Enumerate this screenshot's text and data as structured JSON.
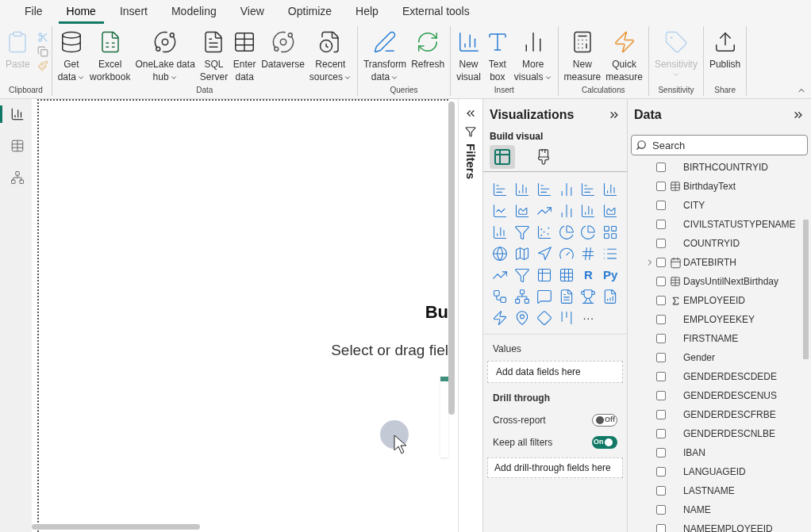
{
  "menu_tabs": [
    {
      "label": "File",
      "selected": false
    },
    {
      "label": "Home",
      "selected": true
    },
    {
      "label": "Insert",
      "selected": false
    },
    {
      "label": "Modeling",
      "selected": false
    },
    {
      "label": "View",
      "selected": false
    },
    {
      "label": "Optimize",
      "selected": false
    },
    {
      "label": "Help",
      "selected": false
    },
    {
      "label": "External tools",
      "selected": false
    }
  ],
  "ribbon": {
    "groups": [
      {
        "kind": "clipboard",
        "label": "Clipboard",
        "buttons": [
          {
            "label_lines": [
              "Paste"
            ],
            "menu": false,
            "disabled": true
          }
        ]
      },
      {
        "kind": "large",
        "label": "Data",
        "buttons": [
          {
            "label_lines": [
              "Get",
              "data"
            ],
            "menu": true,
            "disabled": false
          },
          {
            "label_lines": [
              "Excel",
              "workbook"
            ],
            "menu": false,
            "disabled": false
          },
          {
            "label_lines": [
              "OneLake data",
              "hub"
            ],
            "menu": true,
            "disabled": false
          },
          {
            "label_lines": [
              "SQL",
              "Server"
            ],
            "menu": false,
            "disabled": false
          },
          {
            "label_lines": [
              "Enter",
              "data"
            ],
            "menu": false,
            "disabled": false
          },
          {
            "label_lines": [
              "Dataverse"
            ],
            "menu": false,
            "disabled": false
          },
          {
            "label_lines": [
              "Recent",
              "sources"
            ],
            "menu": true,
            "disabled": false
          }
        ]
      },
      {
        "kind": "large",
        "label": "Queries",
        "buttons": [
          {
            "label_lines": [
              "Transform",
              "data"
            ],
            "menu": true,
            "disabled": false
          },
          {
            "label_lines": [
              "Refresh"
            ],
            "menu": false,
            "disabled": false
          }
        ]
      },
      {
        "kind": "large",
        "label": "Insert",
        "buttons": [
          {
            "label_lines": [
              "New",
              "visual"
            ],
            "menu": false,
            "disabled": false
          },
          {
            "label_lines": [
              "Text",
              "box"
            ],
            "menu": false,
            "disabled": false
          },
          {
            "label_lines": [
              "More",
              "visuals"
            ],
            "menu": true,
            "disabled": false
          }
        ]
      },
      {
        "kind": "large",
        "label": "Calculations",
        "buttons": [
          {
            "label_lines": [
              "New",
              "measure"
            ],
            "menu": false,
            "disabled": false
          },
          {
            "label_lines": [
              "Quick",
              "measure"
            ],
            "menu": false,
            "disabled": false
          }
        ]
      },
      {
        "kind": "large",
        "label": "Sensitivity",
        "buttons": [
          {
            "label_lines": [
              "Sensitivity"
            ],
            "menu": true,
            "disabled": true
          }
        ]
      },
      {
        "kind": "large",
        "label": "Share",
        "buttons": [
          {
            "label_lines": [
              "Publish"
            ],
            "menu": false,
            "disabled": false
          }
        ]
      }
    ]
  },
  "nav": [
    {
      "selected": true
    },
    {
      "selected": false
    },
    {
      "selected": false
    }
  ],
  "canvas": {
    "title": "Bu",
    "subtitle": "Select or drag fiel"
  },
  "filters": {
    "label": "Filters"
  },
  "visualizations": {
    "title": "Visualizations",
    "section": "Build visual",
    "build_tabs": [
      {
        "selected": true
      },
      {
        "selected": false
      }
    ],
    "gallery": [
      {
        "kind": "icon"
      },
      {
        "kind": "icon"
      },
      {
        "kind": "icon"
      },
      {
        "kind": "icon"
      },
      {
        "kind": "icon"
      },
      {
        "kind": "icon"
      },
      {
        "kind": "icon"
      },
      {
        "kind": "icon"
      },
      {
        "kind": "icon"
      },
      {
        "kind": "icon"
      },
      {
        "kind": "icon"
      },
      {
        "kind": "icon"
      },
      {
        "kind": "icon"
      },
      {
        "kind": "icon"
      },
      {
        "kind": "icon"
      },
      {
        "kind": "icon"
      },
      {
        "kind": "icon"
      },
      {
        "kind": "icon"
      },
      {
        "kind": "icon"
      },
      {
        "kind": "icon"
      },
      {
        "kind": "icon"
      },
      {
        "kind": "icon"
      },
      {
        "kind": "icon"
      },
      {
        "kind": "icon"
      },
      {
        "kind": "icon"
      },
      {
        "kind": "icon"
      },
      {
        "kind": "icon"
      },
      {
        "kind": "icon"
      },
      {
        "kind": "text",
        "text": "R"
      },
      {
        "kind": "text",
        "text": "Py"
      },
      {
        "kind": "icon"
      },
      {
        "kind": "icon"
      },
      {
        "kind": "icon"
      },
      {
        "kind": "icon"
      },
      {
        "kind": "icon"
      },
      {
        "kind": "icon"
      },
      {
        "kind": "icon"
      },
      {
        "kind": "icon"
      },
      {
        "kind": "icon"
      },
      {
        "kind": "icon"
      },
      {
        "kind": "more",
        "text": "···"
      }
    ],
    "values_label": "Values",
    "values_placeholder": "Add data fields here",
    "drill_label": "Drill through",
    "toggles": [
      {
        "label": "Cross-report",
        "on": false,
        "state_text": "Off"
      },
      {
        "label": "Keep all filters",
        "on": true,
        "state_text": "On"
      }
    ],
    "drill_placeholder": "Add drill-through fields here"
  },
  "data": {
    "title": "Data",
    "search_placeholder": "Search",
    "fields": [
      {
        "name": "BIRTHCOUNTRYID",
        "kind": "plain",
        "checked": false
      },
      {
        "name": "BirthdayText",
        "kind": "calculated",
        "checked": false
      },
      {
        "name": "CITY",
        "kind": "plain",
        "checked": false
      },
      {
        "name": "CIVILSTATUSTYPENAME",
        "kind": "plain",
        "checked": false
      },
      {
        "name": "COUNTRYID",
        "kind": "plain",
        "checked": false
      },
      {
        "name": "DATEBIRTH",
        "kind": "date",
        "checked": false,
        "expanded": false
      },
      {
        "name": "DaysUntilNextBirthday",
        "kind": "calculated-sum",
        "checked": false
      },
      {
        "name": "EMPLOYEEID",
        "kind": "sum",
        "checked": false
      },
      {
        "name": "EMPLOYEEKEY",
        "kind": "plain",
        "checked": false
      },
      {
        "name": "FIRSTNAME",
        "kind": "plain",
        "checked": false
      },
      {
        "name": "Gender",
        "kind": "plain",
        "checked": false
      },
      {
        "name": "GENDERDESCDEDE",
        "kind": "plain",
        "checked": false
      },
      {
        "name": "GENDERDESCENUS",
        "kind": "plain",
        "checked": false
      },
      {
        "name": "GENDERDESCFRBE",
        "kind": "plain",
        "checked": false
      },
      {
        "name": "GENDERDESCNLBE",
        "kind": "plain",
        "checked": false
      },
      {
        "name": "IBAN",
        "kind": "plain",
        "checked": false
      },
      {
        "name": "LANGUAGEID",
        "kind": "plain",
        "checked": false
      },
      {
        "name": "LASTNAME",
        "kind": "plain",
        "checked": false
      },
      {
        "name": "NAME",
        "kind": "plain",
        "checked": false
      },
      {
        "name": "NAMEEMPLOYEEID",
        "kind": "plain",
        "checked": false
      }
    ]
  }
}
